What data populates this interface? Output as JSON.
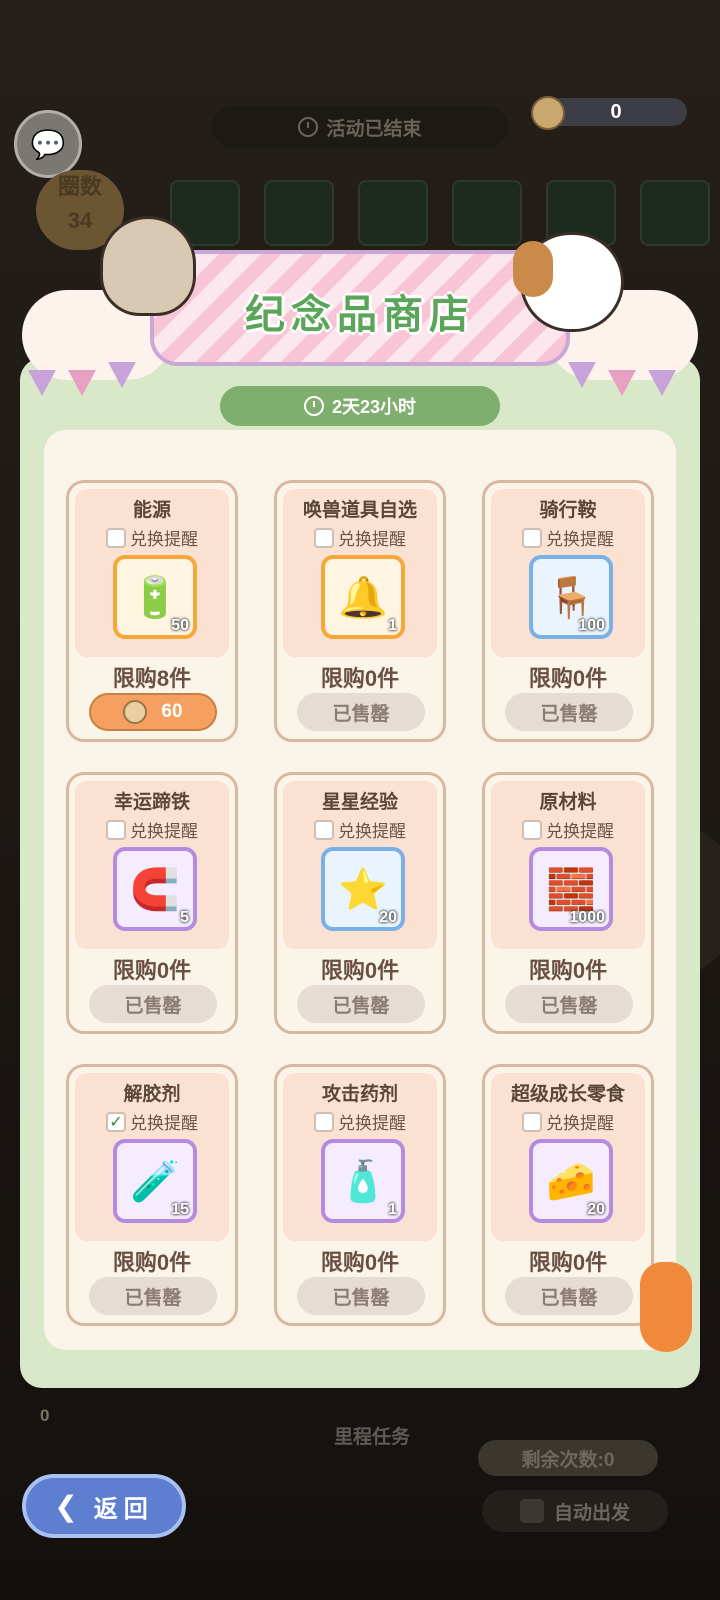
{
  "top": {
    "event_status": "活动已结束",
    "coin_count": "0",
    "lap_label": "圈数",
    "lap_value": "34"
  },
  "shop": {
    "title": "纪念品商店",
    "timer": "2天23小时"
  },
  "items": [
    {
      "name": "能源",
      "remind": "兑换提醒",
      "checked": false,
      "qty": "50",
      "icon": "🔋",
      "frame": "gold",
      "limit": "限购8件",
      "button": "60",
      "sold": false
    },
    {
      "name": "唤兽道具自选",
      "remind": "兑换提醒",
      "checked": false,
      "qty": "1",
      "icon": "🔔",
      "frame": "gold",
      "limit": "限购0件",
      "button": "已售罄",
      "sold": true
    },
    {
      "name": "骑行鞍",
      "remind": "兑换提醒",
      "checked": false,
      "qty": "100",
      "icon": "🪑",
      "frame": "blue",
      "limit": "限购0件",
      "button": "已售罄",
      "sold": true
    },
    {
      "name": "幸运蹄铁",
      "remind": "兑换提醒",
      "checked": false,
      "qty": "5",
      "icon": "🧲",
      "frame": "purple",
      "limit": "限购0件",
      "button": "已售罄",
      "sold": true
    },
    {
      "name": "星星经验",
      "remind": "兑换提醒",
      "checked": false,
      "qty": "20",
      "icon": "⭐",
      "frame": "blue",
      "limit": "限购0件",
      "button": "已售罄",
      "sold": true
    },
    {
      "name": "原材料",
      "remind": "兑换提醒",
      "checked": false,
      "qty": "1000",
      "icon": "🧱",
      "frame": "purple",
      "limit": "限购0件",
      "button": "已售罄",
      "sold": true
    },
    {
      "name": "解胶剂",
      "remind": "兑换提醒",
      "checked": true,
      "qty": "15",
      "icon": "🧪",
      "frame": "purple",
      "limit": "限购0件",
      "button": "已售罄",
      "sold": true
    },
    {
      "name": "攻击药剂",
      "remind": "兑换提醒",
      "checked": false,
      "qty": "1",
      "icon": "🧴",
      "frame": "purple",
      "limit": "限购0件",
      "button": "已售罄",
      "sold": true
    },
    {
      "name": "超级成长零食",
      "remind": "兑换提醒",
      "checked": false,
      "qty": "20",
      "icon": "🧀",
      "frame": "purple",
      "limit": "限购0件",
      "button": "已售罄",
      "sold": true
    }
  ],
  "bottom": {
    "milestone": "里程任务",
    "remaining": "剩余次数:0",
    "auto_start": "自动出发",
    "back": "返回",
    "left_count": "0"
  }
}
